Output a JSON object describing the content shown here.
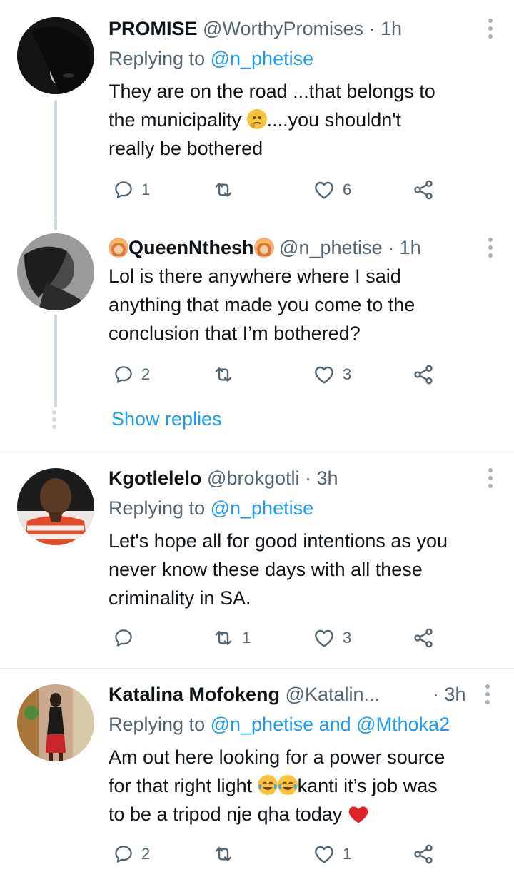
{
  "tweets": [
    {
      "name": "PROMISE",
      "handle": "@WorthyPromises",
      "sep": "·",
      "time": "1h",
      "replying_prefix": "Replying to ",
      "replying_to": "@n_phetise",
      "text_1": "They are on the road ...that belongs to",
      "text_2": "the municipality",
      "text_3": "....you shouldn't",
      "text_4": "really be bothered",
      "replies": "1",
      "retweets": "",
      "likes": "6",
      "avatar_icon": "avatar-photo"
    },
    {
      "name": "QueenNthesh",
      "handle": "@n_phetise",
      "sep": "·",
      "time": "1h",
      "text_1": "Lol is there anywhere where I said",
      "text_2": "anything that made you come to the",
      "text_3": "conclusion that I’m bothered?",
      "replies": "2",
      "retweets": "",
      "likes": "3",
      "avatar_icon": "avatar-photo"
    },
    {
      "name": "Kgotlelelo",
      "handle": "@brokgotli",
      "sep": "·",
      "time": "3h",
      "replying_prefix": "Replying to ",
      "replying_to": "@n_phetise",
      "text_1": "Let's hope all for good intentions as you",
      "text_2": "never know these days with all these",
      "text_3": "criminality in SA.",
      "replies": "",
      "retweets": "1",
      "likes": "3",
      "avatar_icon": "avatar-photo"
    },
    {
      "name": "Katalina Mofokeng",
      "handle": "@Katalin...",
      "sep": "·",
      "time": "3h",
      "replying_prefix": "Replying to ",
      "replying_to": "@n_phetise",
      "replying_and": " and ",
      "replying_to_2": "@Mthoka2",
      "text_1a": "Am out here looking for a power source",
      "text_2a": "for that right light",
      "text_2b": "kanti it’s job was",
      "text_3a": "to be a tripod nje qha today",
      "replies": "2",
      "retweets": "",
      "likes": "1",
      "avatar_icon": "avatar-photo"
    }
  ],
  "show_replies_label": "Show replies",
  "colors": {
    "link": "#1d9bf0",
    "muted": "#536471",
    "text": "#0f1419",
    "divider": "#e6ecf0"
  }
}
